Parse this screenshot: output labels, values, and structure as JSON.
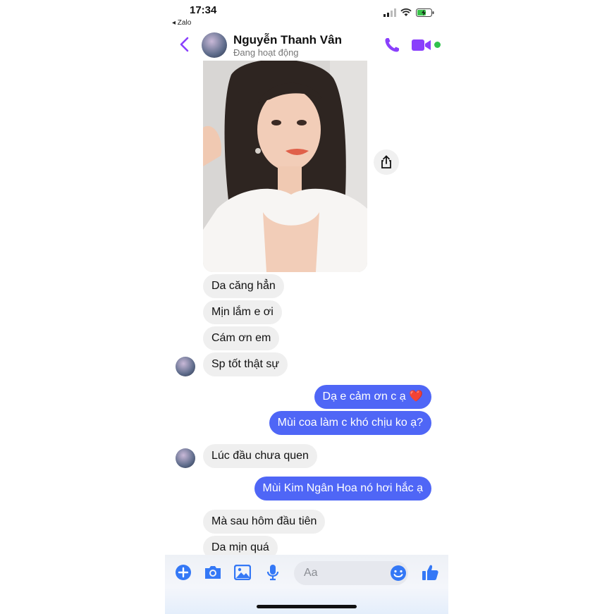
{
  "status": {
    "time": "17:34",
    "back_app": "◂ Zalo"
  },
  "header": {
    "contact_name": "Nguyễn Thanh Vân",
    "status_text": "Đang hoạt động"
  },
  "messages": [
    {
      "from": "in",
      "text": "Da căng hẳn"
    },
    {
      "from": "in",
      "text": "Mịn lắm e ơi"
    },
    {
      "from": "in",
      "text": "Cám ơn em"
    },
    {
      "from": "in",
      "text": "Sp tốt thật sự"
    },
    {
      "from": "out",
      "text": "Dạ e cảm ơn c ạ ❤️"
    },
    {
      "from": "out",
      "text": "Mùi coa làm c khó chịu ko ạ?"
    },
    {
      "from": "in",
      "text": "Lúc đầu chưa quen"
    },
    {
      "from": "out",
      "text": "Mùi Kim Ngân Hoa nó hơi hắc ạ"
    },
    {
      "from": "in",
      "text": "Mà sau hôm đầu tiên"
    },
    {
      "from": "in",
      "text": "Da mịn quá"
    }
  ],
  "composer": {
    "placeholder": "Aa"
  },
  "colors": {
    "accent": "#8a3ffc",
    "outgoing_bubble": "#4f66f6",
    "incoming_bubble": "#efefef",
    "online": "#31c24d"
  },
  "icons": [
    "back-chevron-icon",
    "phone-icon",
    "video-icon",
    "share-icon",
    "plus-icon",
    "camera-icon",
    "gallery-icon",
    "microphone-icon",
    "emoji-icon",
    "thumbs-up-icon"
  ]
}
